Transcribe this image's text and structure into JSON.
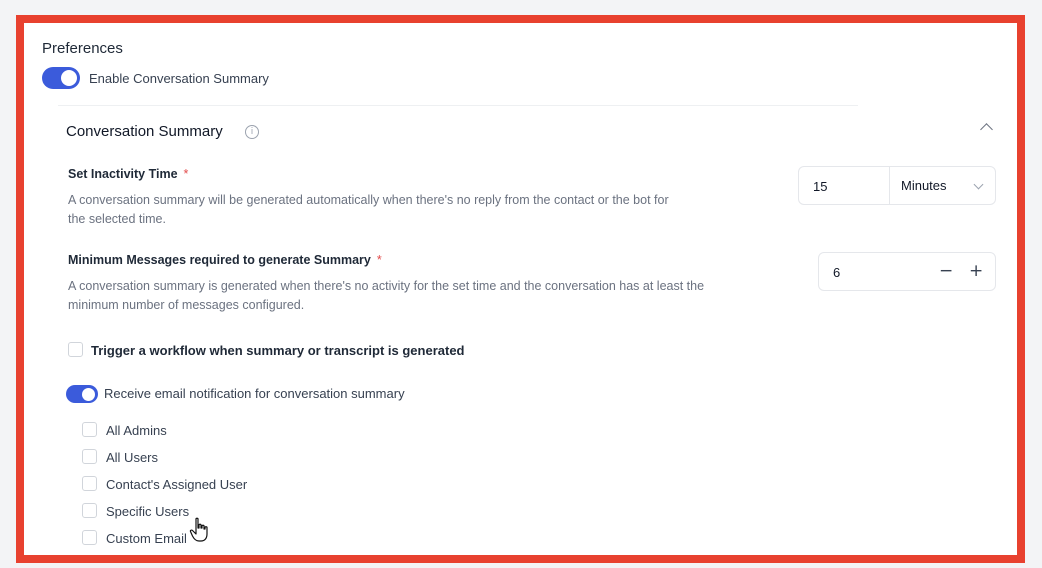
{
  "preferences": {
    "title": "Preferences",
    "enable_summary_label": "Enable Conversation Summary",
    "enable_summary_on": true
  },
  "section": {
    "title": "Conversation Summary",
    "info_icon": "info-icon",
    "collapse_icon": "chevron-up-icon"
  },
  "inactivity": {
    "label": "Set Inactivity Time",
    "required_mark": "*",
    "description_line1": "A conversation summary will be generated automatically when there's no reply from the contact or the bot for",
    "description_line2": "the selected time.",
    "value": "15",
    "unit": "Minutes"
  },
  "min_messages": {
    "label": "Minimum Messages required to generate Summary",
    "required_mark": "*",
    "description_line1": "A conversation summary is generated when there's no activity for the set time and the conversation has at least the",
    "description_line2": "minimum number of messages configured.",
    "value": "6",
    "minus": "−",
    "plus": "+"
  },
  "trigger_workflow": {
    "label": "Trigger a workflow when summary or transcript is generated",
    "checked": false
  },
  "email_notification": {
    "label": "Receive email notification for conversation summary",
    "on": true
  },
  "recipients": [
    {
      "label": "All Admins",
      "checked": false
    },
    {
      "label": "All Users",
      "checked": false
    },
    {
      "label": "Contact's Assigned User",
      "checked": false
    },
    {
      "label": "Specific Users",
      "checked": false
    },
    {
      "label": "Custom Email",
      "checked": false
    }
  ],
  "colors": {
    "accent": "#3b5bdb",
    "frame": "#e8412f",
    "required": "#e24a4a"
  }
}
